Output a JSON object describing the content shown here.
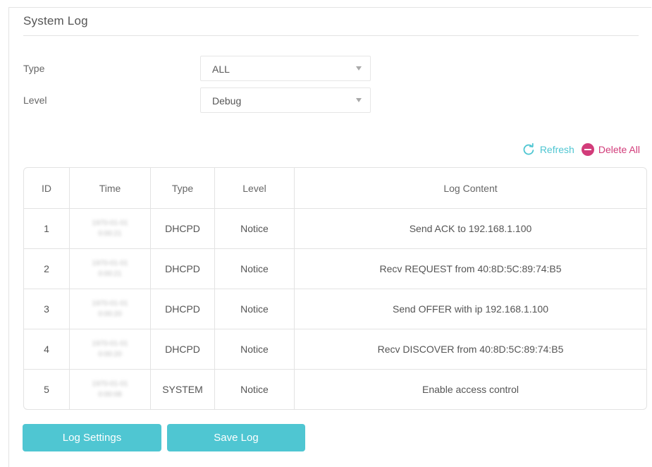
{
  "section_title": "System Log",
  "filters": {
    "type_label": "Type",
    "type_value": "ALL",
    "level_label": "Level",
    "level_value": "Debug"
  },
  "actions": {
    "refresh_label": "Refresh",
    "delete_all_label": "Delete All",
    "refresh_icon": "refresh-icon",
    "delete_icon": "minus-circle-icon"
  },
  "table": {
    "headers": [
      "ID",
      "Time",
      "Type",
      "Level",
      "Log Content"
    ],
    "rows": [
      {
        "id": "1",
        "time_line1": "1970-01-01",
        "time_line2": "0:00:21",
        "type": "DHCPD",
        "level": "Notice",
        "content": "Send ACK to 192.168.1.100"
      },
      {
        "id": "2",
        "time_line1": "1970-01-01",
        "time_line2": "0:00:21",
        "type": "DHCPD",
        "level": "Notice",
        "content": "Recv REQUEST from 40:8D:5C:89:74:B5"
      },
      {
        "id": "3",
        "time_line1": "1970-01-01",
        "time_line2": "0:00:20",
        "type": "DHCPD",
        "level": "Notice",
        "content": "Send OFFER with ip 192.168.1.100"
      },
      {
        "id": "4",
        "time_line1": "1970-01-01",
        "time_line2": "0:00:20",
        "type": "DHCPD",
        "level": "Notice",
        "content": "Recv DISCOVER from 40:8D:5C:89:74:B5"
      },
      {
        "id": "5",
        "time_line1": "1970-01-01",
        "time_line2": "0:00:08",
        "type": "SYSTEM",
        "level": "Notice",
        "content": "Enable access control"
      }
    ]
  },
  "buttons": {
    "log_settings": "Log Settings",
    "save_log": "Save Log"
  },
  "colors": {
    "accent": "#4fc6d2",
    "delete": "#d23c7a",
    "border": "#e3e3e3"
  }
}
